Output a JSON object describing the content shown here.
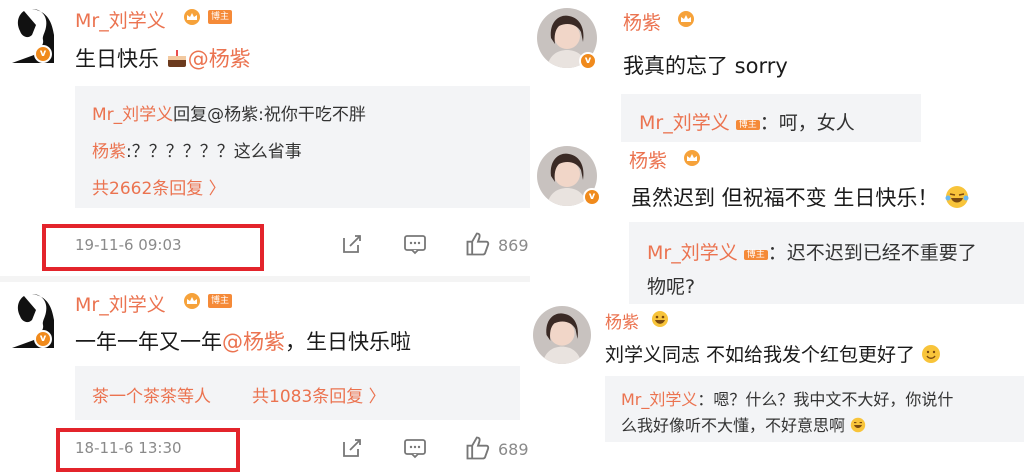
{
  "left": {
    "comments": [
      {
        "author": "Mr_刘学义",
        "badge": "博主",
        "text": "生日快乐",
        "mention": "@杨紫",
        "replies": [
          {
            "name": "Mr_刘学义",
            "text": "回复@杨紫:祝你干吃不胖"
          },
          {
            "name": "杨紫",
            "text": ":？？？？？？这么省事"
          }
        ],
        "more": "共2662条回复 〉",
        "timestamp": "19-11-6 09:03",
        "like_count": "869"
      },
      {
        "author": "Mr_刘学义",
        "badge": "博主",
        "text": "一年一年又一年",
        "mention": "@杨紫",
        "text_after": "，生日快乐啦",
        "replies": [
          {
            "name": "茶一个茶茶等人",
            "text": ""
          }
        ],
        "more": "共1083条回复 〉",
        "timestamp": "18-11-6 13:30",
        "like_count": "689"
      }
    ]
  },
  "right": {
    "comments": [
      {
        "author": "杨紫",
        "text": "我真的忘了 sorry",
        "reply": {
          "name": "Mr_刘学义",
          "badge": "博主",
          "text": "：呵，女人"
        }
      },
      {
        "author": "杨紫",
        "text": "虽然迟到 但祝福不变 生日快乐！",
        "reply": {
          "name": "Mr_刘学义",
          "badge": "博主",
          "text": "：迟不迟到已经不重要了",
          "text2": "物呢?"
        }
      },
      {
        "author": "杨紫",
        "text": "刘学义同志 不如给我发个红包更好了",
        "reply": {
          "name": "Mr_刘学义",
          "text": "：嗯？什么？我中文不大好，你说什",
          "text2": "么我好像听不大懂，不好意思啊"
        }
      }
    ]
  },
  "colors": {
    "accent": "#eb7350",
    "highlight_box": "#e3242b",
    "verified": "#f08a1c",
    "reply_bg": "#f3f4f6"
  },
  "icons": [
    "edit-icon",
    "comment-icon",
    "like-icon",
    "crown-icon",
    "verified-icon",
    "cake-icon",
    "laugh-cry-emoji-icon",
    "smile-emoji-icon",
    "grin-emoji-icon"
  ]
}
